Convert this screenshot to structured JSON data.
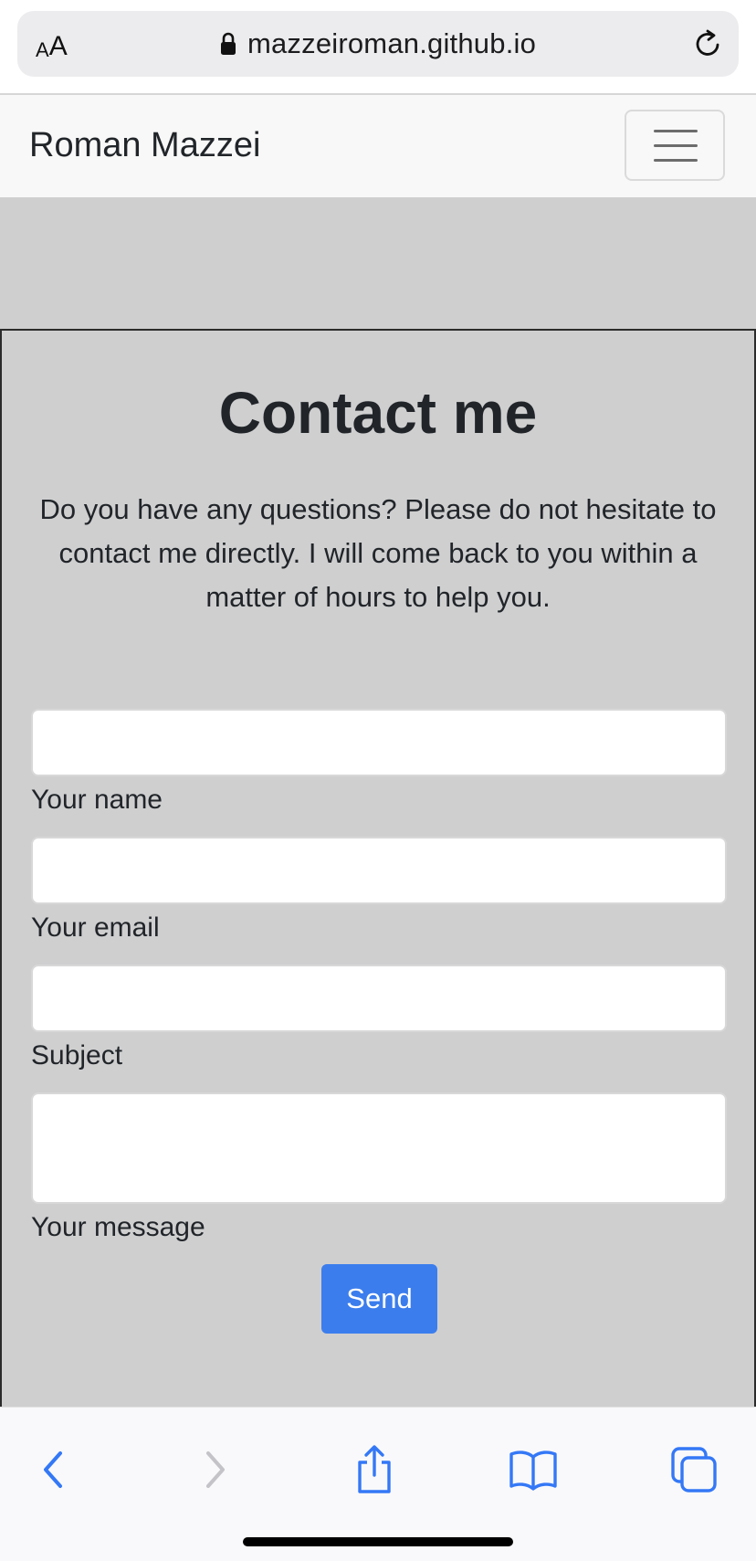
{
  "browser": {
    "text_size_label_small": "A",
    "text_size_label_big": "A",
    "url": "mazzeiroman.github.io"
  },
  "navbar": {
    "brand": "Roman Mazzei"
  },
  "contact": {
    "title": "Contact me",
    "intro": "Do you have any questions? Please do not hesitate to contact me directly. I will come back to you within a matter of hours to help you.",
    "fields": {
      "name": {
        "label": "Your name",
        "value": ""
      },
      "email": {
        "label": "Your email",
        "value": ""
      },
      "subject": {
        "label": "Subject",
        "value": ""
      },
      "message": {
        "label": "Your message",
        "value": ""
      }
    },
    "send_label": "Send"
  },
  "toolbar": {
    "icons": [
      "back-icon",
      "forward-icon",
      "share-icon",
      "bookmarks-icon",
      "tabs-icon"
    ],
    "active_color": "#3478f6",
    "disabled_color": "#c4c4c8"
  },
  "colors": {
    "page_background": "#cfcfd0",
    "navbar_background": "#f8f8f8",
    "button_primary": "#3b7ded"
  }
}
